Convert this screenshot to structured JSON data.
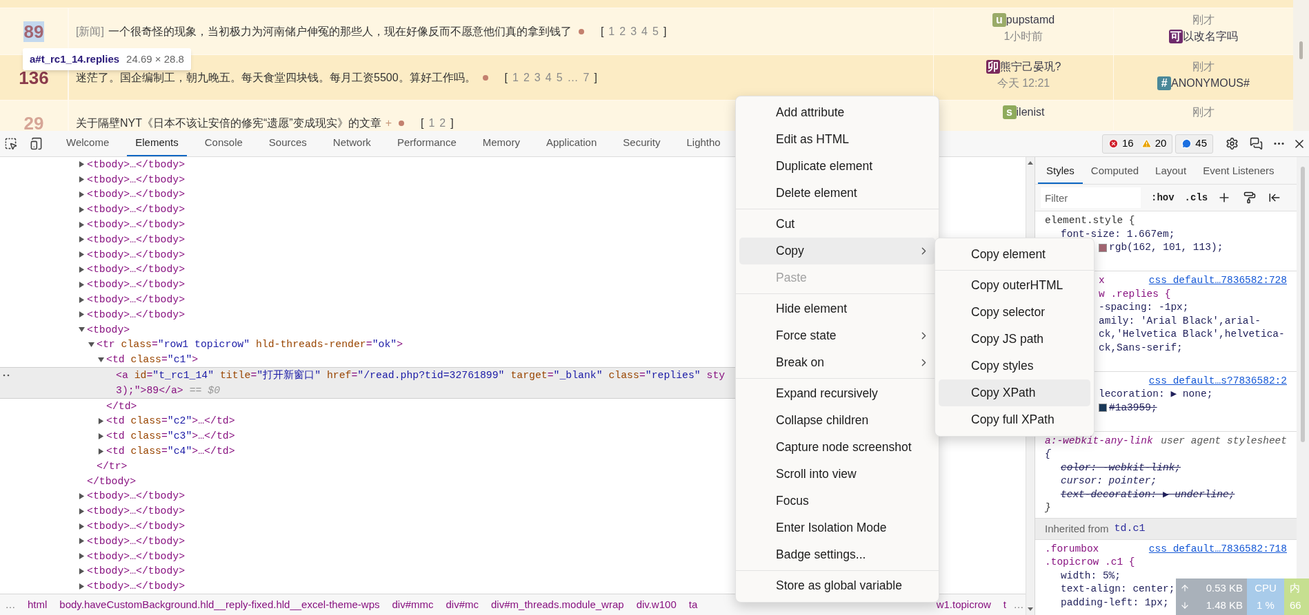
{
  "page": {
    "rows": [
      {
        "replies": "89",
        "color": "#a26571",
        "highlighted": true,
        "tag": "[新闻]",
        "title": "一个很奇怪的现象，当初极力为河南储户伸冤的那些人，现在好像反而不愿意他们真的拿到钱了",
        "pages": {
          "open": "[",
          "items": [
            "1",
            "2",
            "3",
            "4",
            "5"
          ],
          "close": "]"
        },
        "author": {
          "badge": "u",
          "color": "#9aab68",
          "name": "pupstamd",
          "time": "1小时前"
        },
        "last": {
          "time": "刚才",
          "badge": "可",
          "color": "#6e2a6c",
          "name": "以改名字吗"
        }
      },
      {
        "replies": "136",
        "color": "#8a3b4c",
        "highlighted": false,
        "title": "迷茫了。国企编制工，朝九晚五。每天食堂四块钱。每月工资5500。算好工作吗。",
        "pages": {
          "open": "[",
          "items": [
            "1",
            "2",
            "3",
            "4",
            "5",
            "…",
            "7"
          ],
          "close": "]"
        },
        "author": {
          "badge": "卯",
          "color": "#7b2a5c",
          "name": "熊宁己晏巩?",
          "time": "今天 12:21"
        },
        "last": {
          "time": "刚才",
          "badge": "#",
          "color": "#4a8899",
          "name": "ANONYMOUS#"
        }
      },
      {
        "replies": "29",
        "color": "#d6a596",
        "highlighted": false,
        "title": "关于隔壁NYT《日本不该让安倍的修宪“遗愿”变成现实》的文章",
        "marker": "+",
        "pages": {
          "open": "[",
          "items": [
            "1",
            "2"
          ],
          "close": "]"
        },
        "author": {
          "badge": "s",
          "color": "#8fab5c",
          "name": "ilenist"
        },
        "last": {
          "time": "刚才"
        }
      }
    ],
    "tooltip": {
      "selector": "a#t_rc1_14.replies",
      "size": "24.69 × 28.8"
    }
  },
  "devtools": {
    "tabs": [
      {
        "label": "Welcome",
        "selected": false
      },
      {
        "label": "Elements",
        "selected": true
      },
      {
        "label": "Console",
        "selected": false
      },
      {
        "label": "Sources",
        "selected": false
      },
      {
        "label": "Network",
        "selected": false
      },
      {
        "label": "Performance",
        "selected": false
      },
      {
        "label": "Memory",
        "selected": false
      },
      {
        "label": "Application",
        "selected": false
      },
      {
        "label": "Security",
        "selected": false
      },
      {
        "label": "Lightho",
        "selected": false
      }
    ],
    "counts": {
      "errors": "16",
      "warnings": "20",
      "messages": "45"
    },
    "dom": {
      "nodes": [
        {
          "text": "<tbody>…</tbody>",
          "expanded": false,
          "selected": false
        },
        {
          "text": "<tbody>…</tbody>",
          "expanded": false,
          "selected": false
        },
        {
          "text": "<tbody>…</tbody>",
          "expanded": false,
          "selected": false
        },
        {
          "text": "<tbody>…</tbody>",
          "expanded": false,
          "selected": false
        },
        {
          "text": "<tbody>…</tbody>",
          "expanded": false,
          "selected": false
        },
        {
          "text": "<tbody>…</tbody>",
          "expanded": false,
          "selected": false
        },
        {
          "text": "<tbody>…</tbody>",
          "expanded": false,
          "selected": false
        },
        {
          "text": "<tbody>…</tbody>",
          "expanded": false,
          "selected": false
        },
        {
          "text": "<tbody>…</tbody>",
          "expanded": false,
          "selected": false
        },
        {
          "text": "<tbody>…</tbody>",
          "expanded": false,
          "selected": false
        },
        {
          "text": "<tbody>…</tbody>",
          "expanded": false,
          "selected": false
        },
        {
          "text": "<tbody>",
          "expanded": true,
          "selected": false,
          "close": "</tbody>",
          "children": [
            {
              "text": "<tr class=\"row1 topicrow\" hld-threads-render=\"ok\">",
              "expanded": true,
              "selected": false,
              "close": "</tr>",
              "children": [
                {
                  "text": "<td class=\"c1\">",
                  "expanded": true,
                  "selected": false,
                  "close": "</td>",
                  "children": [
                    {
                      "lines": [
                        "<a id=\"t_rc1_14\" title=\"打开新窗口\" href=\"/read.php?tid=32761899\" target=\"_blank\" class=\"replies\" sty",
                        "3);\">89</a>"
                      ],
                      "marker": "== $0",
                      "selected": true
                    }
                  ]
                },
                {
                  "text": "<td class=\"c2\">…</td>",
                  "expanded": false,
                  "selected": false
                },
                {
                  "text": "<td class=\"c3\">…</td>",
                  "expanded": false,
                  "selected": false
                },
                {
                  "text": "<td class=\"c4\">…</td>",
                  "expanded": false,
                  "selected": false
                }
              ]
            }
          ]
        },
        {
          "text": "<tbody>…</tbody>",
          "expanded": false,
          "selected": false
        },
        {
          "text": "<tbody>…</tbody>",
          "expanded": false,
          "selected": false
        },
        {
          "text": "<tbody>…</tbody>",
          "expanded": false,
          "selected": false
        },
        {
          "text": "<tbody>…</tbody>",
          "expanded": false,
          "selected": false
        },
        {
          "text": "<tbody>…</tbody>",
          "expanded": false,
          "selected": false
        },
        {
          "text": "<tbody>…</tbody>",
          "expanded": false,
          "selected": false
        },
        {
          "text": "<tbody>…</tbody>",
          "expanded": false,
          "selected": false
        }
      ]
    },
    "breadcrumb": {
      "more": "…",
      "items": [
        "html",
        "body.haveCustomBackground.hld__reply-fixed.hld__excel-theme-wps",
        "div#mmc",
        "div#mc",
        "div#m_threads.module_wrap",
        "div.w100",
        "ta",
        "w1.topicrow",
        "t"
      ],
      "more_right": "…"
    },
    "styles": {
      "tabs": [
        {
          "label": "Styles",
          "selected": true
        },
        {
          "label": "Computed",
          "selected": false
        },
        {
          "label": "Layout",
          "selected": false
        },
        {
          "label": "Event Listeners",
          "selected": false
        }
      ],
      "filter": {
        "placeholder": "Filter"
      },
      "toggles": [
        ":hov",
        ".cls"
      ],
      "rules": [
        {
          "kind": "author",
          "head": "element.style {",
          "lines": [
            {
              "kind": "prop",
              "text": "font-size: 1.667em;"
            },
            {
              "kind": "prop",
              "text": "rgb(162, 101, 113);",
              "color": "#a26571"
            }
          ]
        },
        {
          "kind": "author",
          "head": "x",
          "source": "css_default…7836582:728",
          "lines": [
            {
              "kind": "selector",
              "text": "w .replies {"
            },
            {
              "kind": "prop",
              "text": "-spacing: -1px;"
            },
            {
              "kind": "prop",
              "text": "amily: 'Arial Black',arial-"
            },
            {
              "kind": "prop",
              "text": "ck,'Helvetica Black',helvetica-"
            },
            {
              "kind": "prop",
              "text": "ck,Sans-serif;"
            }
          ]
        },
        {
          "kind": "author",
          "source": "css_default…s?7836582:2",
          "lines": [
            {
              "kind": "prop",
              "text": "lecoration: ▶ none;"
            },
            {
              "kind": "prop",
              "text": "#1a3959;",
              "color": "#1a3959",
              "struck": true
            }
          ]
        },
        {
          "kind": "user-agent",
          "head": "a:-webkit-any-link",
          "source": "user agent stylesheet",
          "lines": [
            {
              "kind": "brace",
              "text": "{"
            },
            {
              "kind": "prop",
              "text": "color: -webkit-link;",
              "struck": true
            },
            {
              "kind": "prop",
              "text": "cursor: pointer;"
            },
            {
              "kind": "prop",
              "text": "text-decoration: ▶ underline;",
              "struck": true
            }
          ],
          "close": "}"
        },
        {
          "kind": "inherited",
          "label": "Inherited from",
          "element": "td.c1"
        },
        {
          "kind": "author",
          "head": ".forumbox",
          "source": "css_default…7836582:718",
          "lines": [
            {
              "kind": "selector",
              "text": ".topicrow .c1 {"
            },
            {
              "kind": "prop",
              "text": "width: 5%;"
            },
            {
              "kind": "prop",
              "text": "text-align: center;"
            },
            {
              "kind": "prop",
              "text": "padding-left: 1px;"
            }
          ]
        }
      ]
    },
    "meter": {
      "upload": "0.53 KB",
      "download": "1.48 KB",
      "cpu_label": "CPU",
      "cpu": "1 %",
      "mem_label": "内",
      "mem": "66"
    }
  },
  "context_menu": {
    "items": [
      {
        "kind": "item",
        "label": "Add attribute",
        "highlighted": false,
        "disabled": false
      },
      {
        "kind": "item",
        "label": "Edit as HTML",
        "highlighted": false,
        "disabled": false
      },
      {
        "kind": "item",
        "label": "Duplicate element",
        "highlighted": false,
        "disabled": false
      },
      {
        "kind": "item",
        "label": "Delete element",
        "highlighted": false,
        "disabled": false
      },
      {
        "kind": "separator"
      },
      {
        "kind": "item",
        "label": "Cut",
        "highlighted": false,
        "disabled": false
      },
      {
        "kind": "submenu",
        "label": "Copy",
        "highlighted": true,
        "disabled": false
      },
      {
        "kind": "item",
        "label": "Paste",
        "highlighted": false,
        "disabled": true
      },
      {
        "kind": "separator"
      },
      {
        "kind": "item",
        "label": "Hide element",
        "highlighted": false,
        "disabled": false
      },
      {
        "kind": "submenu",
        "label": "Force state",
        "highlighted": false,
        "disabled": false
      },
      {
        "kind": "submenu",
        "label": "Break on",
        "highlighted": false,
        "disabled": false
      },
      {
        "kind": "separator"
      },
      {
        "kind": "item",
        "label": "Expand recursively",
        "highlighted": false,
        "disabled": false
      },
      {
        "kind": "item",
        "label": "Collapse children",
        "highlighted": false,
        "disabled": false
      },
      {
        "kind": "item",
        "label": "Capture node screenshot",
        "highlighted": false,
        "disabled": false
      },
      {
        "kind": "item",
        "label": "Scroll into view",
        "highlighted": false,
        "disabled": false
      },
      {
        "kind": "item",
        "label": "Focus",
        "highlighted": false,
        "disabled": false
      },
      {
        "kind": "item",
        "label": "Enter Isolation Mode",
        "highlighted": false,
        "disabled": false
      },
      {
        "kind": "item",
        "label": "Badge settings...",
        "highlighted": false,
        "disabled": false
      },
      {
        "kind": "separator"
      },
      {
        "kind": "item",
        "label": "Store as global variable",
        "highlighted": false,
        "disabled": false
      }
    ]
  },
  "submenu": {
    "items": [
      {
        "kind": "item",
        "label": "Copy element",
        "highlighted": false,
        "disabled": false
      },
      {
        "kind": "separator"
      },
      {
        "kind": "item",
        "label": "Copy outerHTML",
        "highlighted": false,
        "disabled": false
      },
      {
        "kind": "item",
        "label": "Copy selector",
        "highlighted": false,
        "disabled": false
      },
      {
        "kind": "item",
        "label": "Copy JS path",
        "highlighted": false,
        "disabled": false
      },
      {
        "kind": "item",
        "label": "Copy styles",
        "highlighted": false,
        "disabled": false
      },
      {
        "kind": "item",
        "label": "Copy XPath",
        "highlighted": true,
        "disabled": false
      },
      {
        "kind": "item",
        "label": "Copy full XPath",
        "highlighted": false,
        "disabled": false
      }
    ]
  }
}
